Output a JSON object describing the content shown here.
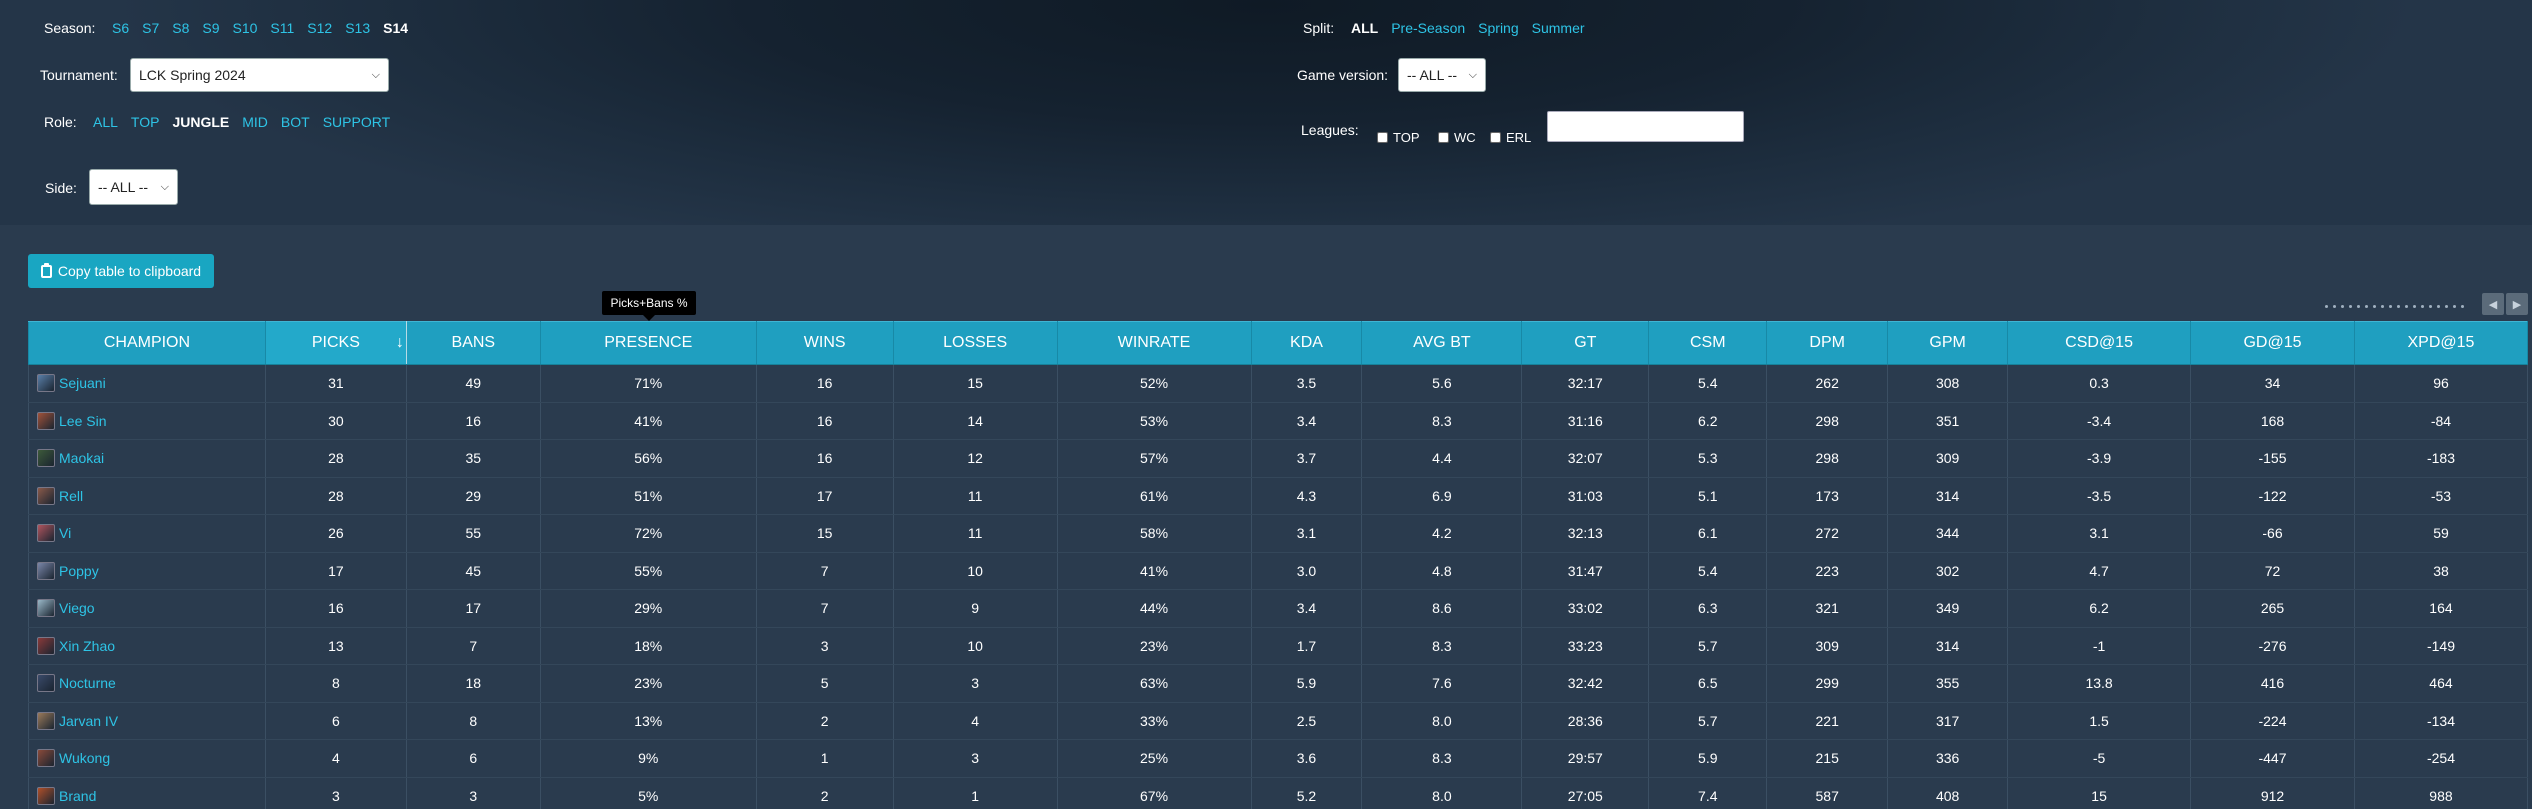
{
  "filters": {
    "season": {
      "label": "Season:",
      "options": [
        "S6",
        "S7",
        "S8",
        "S9",
        "S10",
        "S11",
        "S12",
        "S13",
        "S14"
      ],
      "active": "S14"
    },
    "split": {
      "label": "Split:",
      "options": [
        "ALL",
        "Pre-Season",
        "Spring",
        "Summer"
      ],
      "active": "ALL"
    },
    "tournament": {
      "label": "Tournament:",
      "value": "LCK Spring 2024"
    },
    "game_version": {
      "label": "Game version:",
      "value": "-- ALL --"
    },
    "role": {
      "label": "Role:",
      "options": [
        "ALL",
        "TOP",
        "JUNGLE",
        "MID",
        "BOT",
        "SUPPORT"
      ],
      "active": "JUNGLE"
    },
    "leagues": {
      "label": "Leagues:",
      "checkboxes": [
        "TOP",
        "WC",
        "ERL"
      ]
    },
    "side": {
      "label": "Side:",
      "value": "-- ALL --"
    }
  },
  "copy_button": "Copy table to clipboard",
  "tooltip": "Picks+Bans %",
  "columns": [
    "CHAMPION",
    "PICKS",
    "BANS",
    "PRESENCE",
    "WINS",
    "LOSSES",
    "WINRATE",
    "KDA",
    "AVG BT",
    "GT",
    "CSM",
    "DPM",
    "GPM",
    "CSD@15",
    "GD@15",
    "XPD@15"
  ],
  "sort_arrow": "↓",
  "rows": [
    {
      "champ": "Sejuani",
      "icon_color": "#5a7fa8",
      "cells": [
        "31",
        "49",
        "71%",
        "16",
        "15",
        "52%",
        "3.5",
        "5.6",
        "32:17",
        "5.4",
        "262",
        "308",
        "0.3",
        "34",
        "96"
      ]
    },
    {
      "champ": "Lee Sin",
      "icon_color": "#a0523a",
      "cells": [
        "30",
        "16",
        "41%",
        "16",
        "14",
        "53%",
        "3.4",
        "8.3",
        "31:16",
        "6.2",
        "298",
        "351",
        "-3.4",
        "168",
        "-84"
      ]
    },
    {
      "champ": "Maokai",
      "icon_color": "#3d5a3a",
      "cells": [
        "28",
        "35",
        "56%",
        "16",
        "12",
        "57%",
        "3.7",
        "4.4",
        "32:07",
        "5.3",
        "298",
        "309",
        "-3.9",
        "-155",
        "-183"
      ]
    },
    {
      "champ": "Rell",
      "icon_color": "#8a5a4a",
      "cells": [
        "28",
        "29",
        "51%",
        "17",
        "11",
        "61%",
        "4.3",
        "6.9",
        "31:03",
        "5.1",
        "173",
        "314",
        "-3.5",
        "-122",
        "-53"
      ]
    },
    {
      "champ": "Vi",
      "icon_color": "#b0555e",
      "cells": [
        "26",
        "55",
        "72%",
        "15",
        "11",
        "58%",
        "3.1",
        "4.2",
        "32:13",
        "6.1",
        "272",
        "344",
        "3.1",
        "-66",
        "59"
      ]
    },
    {
      "champ": "Poppy",
      "icon_color": "#7a86a8",
      "cells": [
        "17",
        "45",
        "55%",
        "7",
        "10",
        "41%",
        "3.0",
        "4.8",
        "31:47",
        "5.4",
        "223",
        "302",
        "4.7",
        "72",
        "38"
      ]
    },
    {
      "champ": "Viego",
      "icon_color": "#9ab8c8",
      "cells": [
        "16",
        "17",
        "29%",
        "7",
        "9",
        "44%",
        "3.4",
        "8.6",
        "33:02",
        "6.3",
        "321",
        "349",
        "6.2",
        "265",
        "164"
      ]
    },
    {
      "champ": "Xin Zhao",
      "icon_color": "#8a3a3a",
      "cells": [
        "13",
        "7",
        "18%",
        "3",
        "10",
        "23%",
        "1.7",
        "8.3",
        "33:23",
        "5.7",
        "309",
        "314",
        "-1",
        "-276",
        "-149"
      ]
    },
    {
      "champ": "Nocturne",
      "icon_color": "#3a4a6a",
      "cells": [
        "8",
        "18",
        "23%",
        "5",
        "3",
        "63%",
        "5.9",
        "7.6",
        "32:42",
        "6.5",
        "299",
        "355",
        "13.8",
        "416",
        "464"
      ]
    },
    {
      "champ": "Jarvan IV",
      "icon_color": "#9a7a5a",
      "cells": [
        "6",
        "8",
        "13%",
        "2",
        "4",
        "33%",
        "2.5",
        "8.0",
        "28:36",
        "5.7",
        "221",
        "317",
        "1.5",
        "-224",
        "-134"
      ]
    },
    {
      "champ": "Wukong",
      "icon_color": "#8a4a3a",
      "cells": [
        "4",
        "6",
        "9%",
        "1",
        "3",
        "25%",
        "3.6",
        "8.3",
        "29:57",
        "5.9",
        "215",
        "336",
        "-5",
        "-447",
        "-254"
      ]
    },
    {
      "champ": "Brand",
      "icon_color": "#b0502a",
      "cells": [
        "3",
        "3",
        "5%",
        "2",
        "1",
        "67%",
        "5.2",
        "8.0",
        "27:05",
        "7.4",
        "587",
        "408",
        "15",
        "912",
        "988"
      ]
    }
  ]
}
